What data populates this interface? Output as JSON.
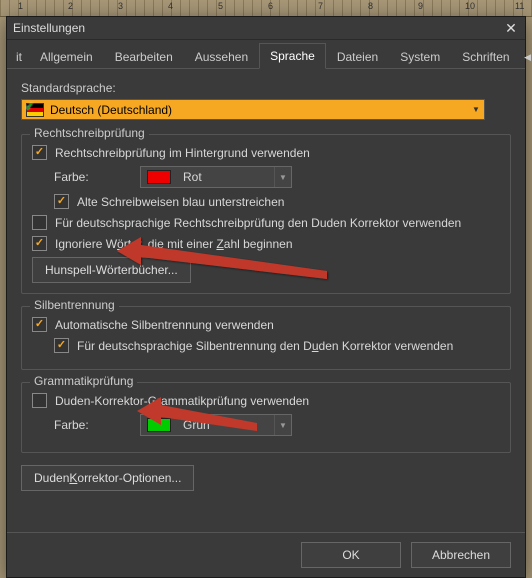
{
  "window": {
    "title": "Einstellungen"
  },
  "tabs": {
    "cut": "it",
    "allgemein": "Allgemein",
    "bearbeiten": "Bearbeiten",
    "aussehen": "Aussehen",
    "sprache": "Sprache",
    "dateien": "Dateien",
    "system": "System",
    "schriften": "Schriften"
  },
  "standard": {
    "label": "Standardsprache:",
    "value": "Deutsch (Deutschland)"
  },
  "spell": {
    "legend": "Rechtschreibprüfung",
    "background": "Rechtschreibprüfung im Hintergrund verwenden",
    "color_label": "Farbe:",
    "color_value": "Rot",
    "old_spelling": "Alte Schreibweisen blau unterstreichen",
    "duden": "Für deutschsprachige Rechtschreibprüfung den Duden Korrektor verwenden",
    "ignore_numbers_pre": "Ignoriere W",
    "ignore_numbers_u": "ö",
    "ignore_numbers_mid": "rter, die mit einer ",
    "ignore_numbers_u2": "Z",
    "ignore_numbers_post": "ahl beginnen",
    "hunspell": "Hunspell-Wörterbücher..."
  },
  "hyphen": {
    "legend": "Silbentrennung",
    "auto": "Automatische Silbentrennung verwenden",
    "duden_pre": "Für deutschsprachige Silbentrennung den D",
    "duden_u": "u",
    "duden_post": "den Korrektor verwenden"
  },
  "grammar": {
    "legend": "Grammatikprüfung",
    "duden": "Duden-Korrektor-Grammatikprüfung verwenden",
    "color_label": "Farbe:",
    "color_value": "Grün"
  },
  "duden_options_pre": "Duden ",
  "duden_options_u": "K",
  "duden_options_post": "orrektor-Optionen...",
  "footer": {
    "ok": "OK",
    "cancel": "Abbrechen"
  }
}
